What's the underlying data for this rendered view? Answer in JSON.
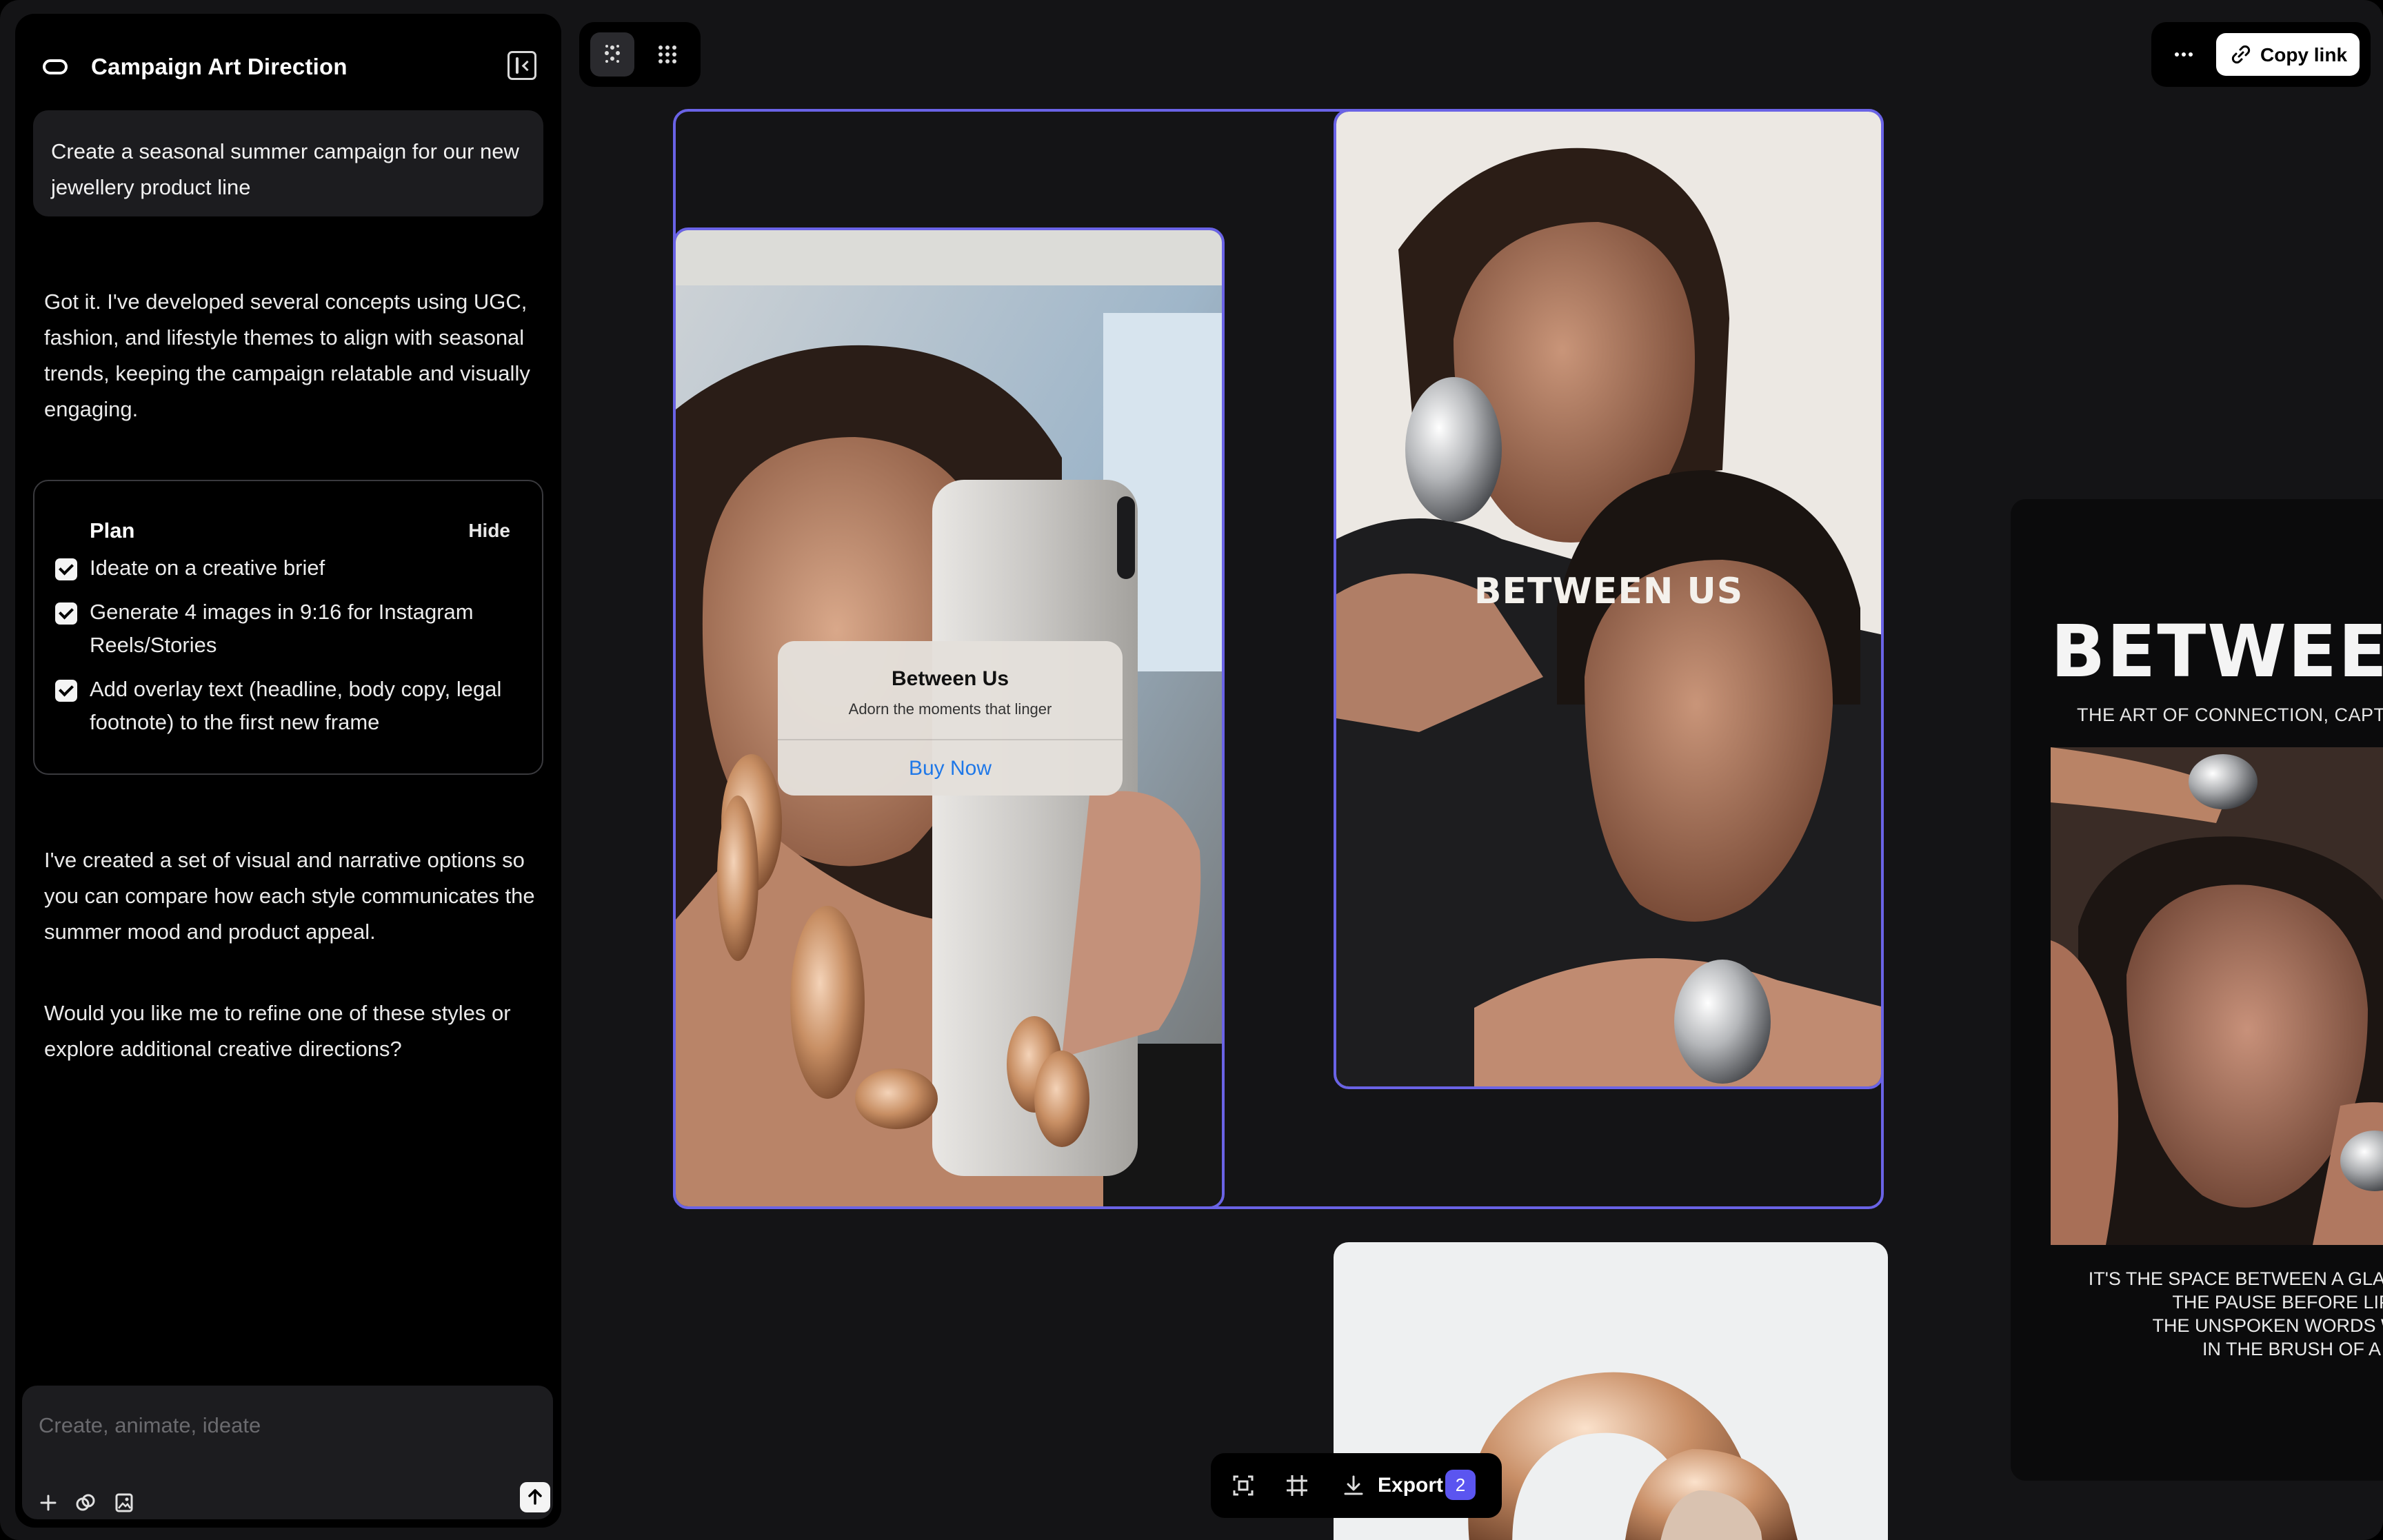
{
  "panel": {
    "title": "Campaign Art Direction",
    "user_message": "Create a seasonal summer campaign for our new jewellery product line",
    "assistant_1": "Got it. I've developed several concepts using UGC, fashion, and lifestyle themes to align with seasonal trends, keeping the campaign relatable and visually engaging.",
    "plan": {
      "title": "Plan",
      "hide_label": "Hide",
      "items": [
        {
          "label": "Ideate on a creative brief",
          "checked": true
        },
        {
          "label": "Generate 4 images in 9:16 for Instagram Reels/Stories",
          "checked": true
        },
        {
          "label": "Add overlay text (headline, body copy, legal footnote) to the first new frame",
          "checked": true
        }
      ]
    },
    "assistant_2": "I've created a set of visual and narrative options so you can compare how each style communicates the summer mood and product appeal.",
    "assistant_3": "Would you like me to refine one of these styles or explore additional creative directions?",
    "composer": {
      "placeholder": "Create, animate, ideate",
      "icons": [
        "plus-icon",
        "link-icon",
        "image-icon",
        "send-arrow-icon"
      ]
    }
  },
  "toolbar": {
    "tools": [
      "sparkle-dots-icon",
      "grid-dots-icon"
    ],
    "more_icon": "more-horizontal-icon",
    "copy_link_label": "Copy link",
    "copy_link_icon": "link-icon"
  },
  "canvas": {
    "frame1": {
      "notif_title": "Between Us",
      "notif_subtitle": "Adorn the moments that linger",
      "notif_button": "Buy Now"
    },
    "frame2": {
      "headline": "BETWEEN US"
    },
    "frame4": {
      "headline": "BETWEEN",
      "subline": "THE ART OF CONNECTION, CAPTUR",
      "copy_lines": [
        "IT'S THE SPACE BETWEEN A GLANCE",
        "THE PAUSE BEFORE LIPS M",
        "THE UNSPOKEN WORDS WRA",
        "IN THE BRUSH OF A HAN"
      ]
    }
  },
  "bottom_bar": {
    "icons": [
      "fit-frame-icon",
      "crop-frame-icon",
      "download-icon"
    ],
    "export_label": "Export",
    "export_count": "2"
  },
  "colors": {
    "background": "#141416",
    "panel": "#000000",
    "accent": "#6a63e6",
    "badge": "#5b55f0",
    "link_blue": "#1f78e8"
  }
}
